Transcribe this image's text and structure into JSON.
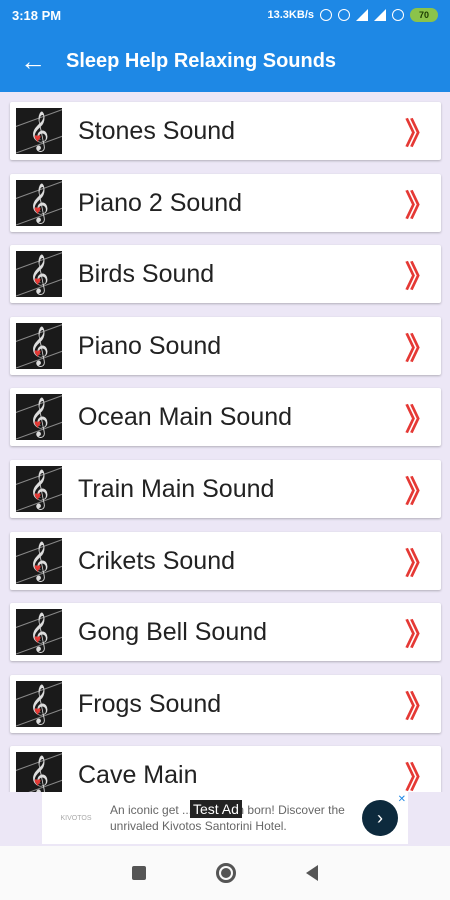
{
  "status": {
    "time": "3:18 PM",
    "net_speed": "13.3KB/s",
    "battery": "70"
  },
  "appbar": {
    "title": "Sleep Help Relaxing Sounds",
    "back_icon": "←"
  },
  "sounds": [
    {
      "label": "Stones Sound"
    },
    {
      "label": "Piano 2 Sound"
    },
    {
      "label": "Birds Sound"
    },
    {
      "label": "Piano Sound"
    },
    {
      "label": "Ocean Main Sound"
    },
    {
      "label": "Train Main Sound"
    },
    {
      "label": "Crikets Sound"
    },
    {
      "label": "Gong Bell Sound"
    },
    {
      "label": "Frogs Sound"
    },
    {
      "label": "Cave Main"
    }
  ],
  "chevron": "》",
  "ad": {
    "tag": "Test Ad",
    "text": "An iconic get ... just been born! Discover the unrivaled Kivotos Santorini Hotel.",
    "cta_icon": "›"
  },
  "colors": {
    "primary": "#1e88e5",
    "accent": "#e53935"
  }
}
